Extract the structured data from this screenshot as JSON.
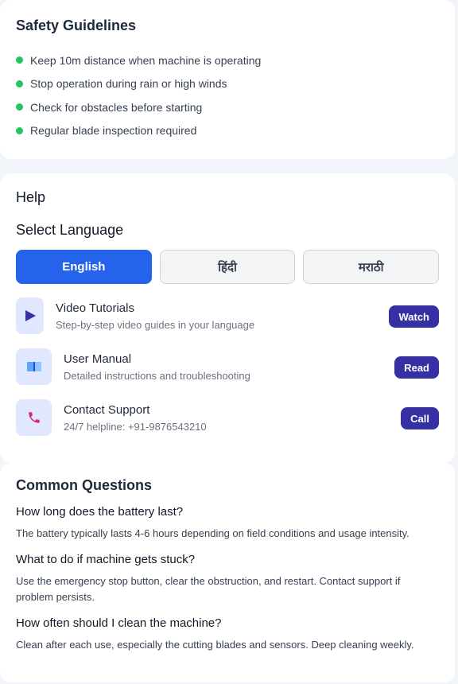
{
  "safety": {
    "title": "Safety Guidelines",
    "items": [
      "Keep 10m distance when machine is operating",
      "Stop operation during rain or high winds",
      "Check for obstacles before starting",
      "Regular blade inspection required"
    ],
    "dot_color": "#22c55e"
  },
  "help": {
    "title": "Help",
    "language_title": "Select Language",
    "languages": [
      {
        "label": "English",
        "selected": true
      },
      {
        "label": "हिंदी",
        "selected": false
      },
      {
        "label": "मराठी",
        "selected": false
      }
    ],
    "items": [
      {
        "icon": "play-icon",
        "name": "Video Tutorials",
        "desc": "Step-by-step video guides in your language",
        "action": "Watch"
      },
      {
        "icon": "book-icon",
        "name": "User Manual",
        "desc": "Detailed instructions and troubleshooting",
        "action": "Read"
      },
      {
        "icon": "phone-icon",
        "name": "Contact Support",
        "desc": "24/7 helpline: +91-9876543210",
        "action": "Call"
      }
    ],
    "accent": "#2563eb",
    "button_color": "#3730a3"
  },
  "faq": {
    "title": "Common Questions",
    "items": [
      {
        "q": "How long does the battery last?",
        "a": "The battery typically lasts 4-6 hours depending on field conditions and usage intensity."
      },
      {
        "q": "What to do if machine gets stuck?",
        "a": "Use the emergency stop button, clear the obstruction, and restart. Contact support if problem persists."
      },
      {
        "q": "How often should I clean the machine?",
        "a": "Clean after each use, especially the cutting blades and sensors. Deep cleaning weekly."
      }
    ]
  }
}
